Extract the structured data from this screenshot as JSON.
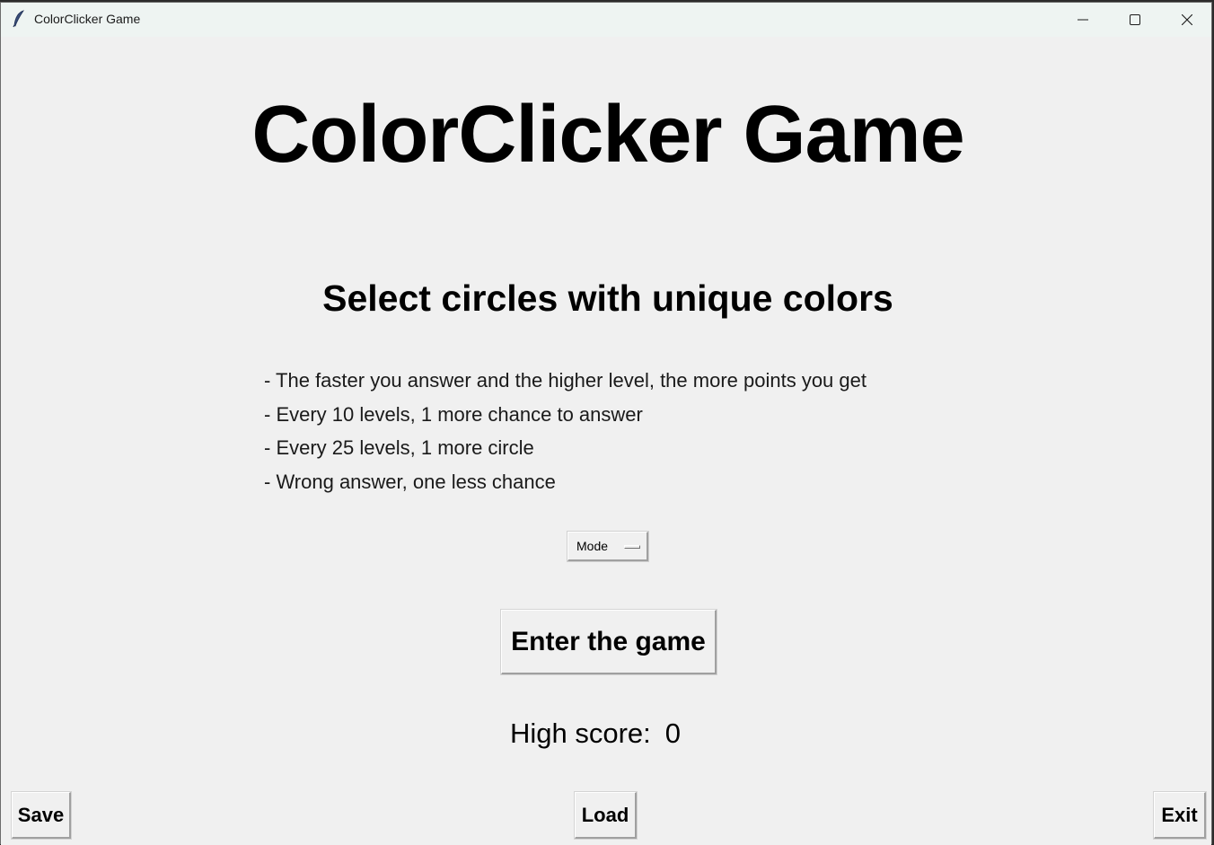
{
  "window": {
    "title": "ColorClicker Game",
    "icon": "feather-icon",
    "controls": [
      "minimize-icon",
      "maximize-icon",
      "close-icon"
    ]
  },
  "main": {
    "heading": "ColorClicker Game",
    "subtitle": "Select circles with unique colors",
    "rules": [
      "- The faster you answer and the higher level, the more points you get",
      "- Every 10 levels, 1 more chance to answer",
      "- Every 25 levels, 1 more circle",
      "- Wrong answer, one less chance"
    ],
    "mode_label": "Mode",
    "enter_label": "Enter the game",
    "high_score_label": "High score:",
    "high_score_value": "0"
  },
  "footer": {
    "save_label": "Save",
    "load_label": "Load",
    "exit_label": "Exit"
  },
  "colors": {
    "background": "#f0f0f0",
    "titlebar": "#eef4f2",
    "text": "#000000"
  }
}
